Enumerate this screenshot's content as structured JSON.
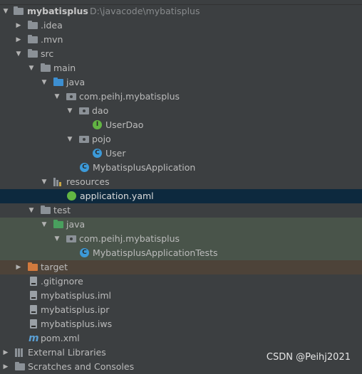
{
  "project": {
    "name": "mybatisplus",
    "path": "D:\\javacode\\mybatisplus"
  },
  "tree": {
    "idea": ".idea",
    "mvn": ".mvn",
    "src": "src",
    "main": "main",
    "main_java": "java",
    "pkg_main": "com.peihj.mybatisplus",
    "dao": "dao",
    "userdao": "UserDao",
    "pojo": "pojo",
    "user": "User",
    "app_class": "MybatisplusApplication",
    "resources": "resources",
    "app_yaml": "application.yaml",
    "test": "test",
    "test_java": "java",
    "pkg_test": "com.peihj.mybatisplus",
    "app_tests": "MybatisplusApplicationTests",
    "target": "target",
    "gitignore": ".gitignore",
    "iml": "mybatisplus.iml",
    "ipr": "mybatisplus.ipr",
    "iws": "mybatisplus.iws",
    "pom": "pom.xml",
    "external_libraries": "External Libraries",
    "scratches": "Scratches and Consoles"
  },
  "icon_letters": {
    "interface": "I",
    "class": "C",
    "maven": "m"
  },
  "watermark": "CSDN @Peihj2021",
  "colors": {
    "selection": "#0d293e",
    "test_bg": "#49544a",
    "excluded_bg": "#4d4339",
    "source_folder": "#3d8fd1",
    "test_folder": "#49a05e",
    "excluded_folder": "#d37a3e"
  }
}
